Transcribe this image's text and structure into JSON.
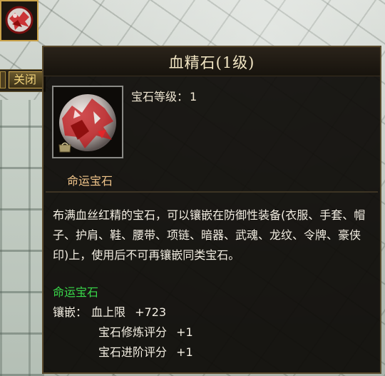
{
  "slot": {
    "icon": "blood-essence-gem-icon"
  },
  "close_button": {
    "label": "关闭"
  },
  "tooltip": {
    "title": "血精石(1级)",
    "level_label": "宝石等级：",
    "level_value": "1",
    "category": "命运宝石",
    "description": "布满血丝红精的宝石，可以镶嵌在防御性装备(衣服、手套、帽子、护肩、鞋、腰带、项链、暗器、武魂、龙纹、令牌、豪侠印)上，使用后不可再镶嵌同类宝石。",
    "gem_type": "命运宝石",
    "inlay_label": "镶嵌：",
    "inlay_stats": [
      {
        "name": "血上限",
        "value": "+723"
      },
      {
        "name": "宝石修炼评分",
        "value": "+1"
      },
      {
        "name": "宝石进阶评分",
        "value": "+1"
      }
    ]
  },
  "colors": {
    "title": "#f2e6c4",
    "category": "#f0c48a",
    "gem_type": "#39d84a",
    "border_gold": "#c9a24a"
  }
}
